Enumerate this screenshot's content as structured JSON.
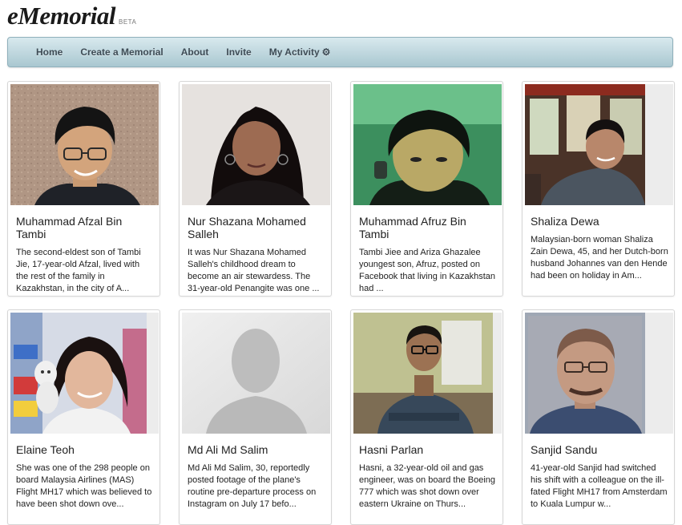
{
  "brand": {
    "logo": "eMemorial",
    "badge": "BETA"
  },
  "nav": [
    {
      "label": "Home"
    },
    {
      "label": "Create a Memorial"
    },
    {
      "label": "About"
    },
    {
      "label": "Invite"
    },
    {
      "label": "My Activity"
    }
  ],
  "cards": [
    {
      "name": "Muhammad Afzal Bin Tambi",
      "desc": "The second-eldest son of Tambi Jie, 17-year-old Afzal, lived with the rest of the family in Kazakhstan, in the city of A..."
    },
    {
      "name": "Nur Shazana Mohamed Salleh",
      "desc": "It was Nur Shazana Mohamed Salleh's childhood dream to become an air stewardess. The 31-year-old Penangite was one ..."
    },
    {
      "name": "Muhammad Afruz Bin Tambi",
      "desc": "Tambi Jiee and Ariza Ghazalee youngest son, Afruz, posted on Facebook that living in Kazakhstan had ..."
    },
    {
      "name": "Shaliza Dewa",
      "desc": "Malaysian-born woman Shaliza Zain Dewa, 45, and her Dutch-born husband Johannes van den Hende had been on holiday in Am..."
    },
    {
      "name": "Elaine Teoh",
      "desc": "She was one of the 298 people on board Malaysia Airlines (MAS) Flight MH17 which was believed to have been shot down ove..."
    },
    {
      "name": "Md Ali Md Salim",
      "desc": "Md Ali Md Salim, 30, reportedly posted footage of the plane's routine pre-departure process on Instagram on July 17 befo..."
    },
    {
      "name": "Hasni Parlan",
      "desc": "Hasni, a 32-year-old oil and gas engineer, was on board the Boeing 777 which was shot down over eastern Ukraine on Thurs..."
    },
    {
      "name": "Sanjid Sandu",
      "desc": "41-year-old Sanjid had switched his shift with a colleague on the ill-fated Flight MH17 from Amsterdam to Kuala Lumpur w..."
    }
  ]
}
